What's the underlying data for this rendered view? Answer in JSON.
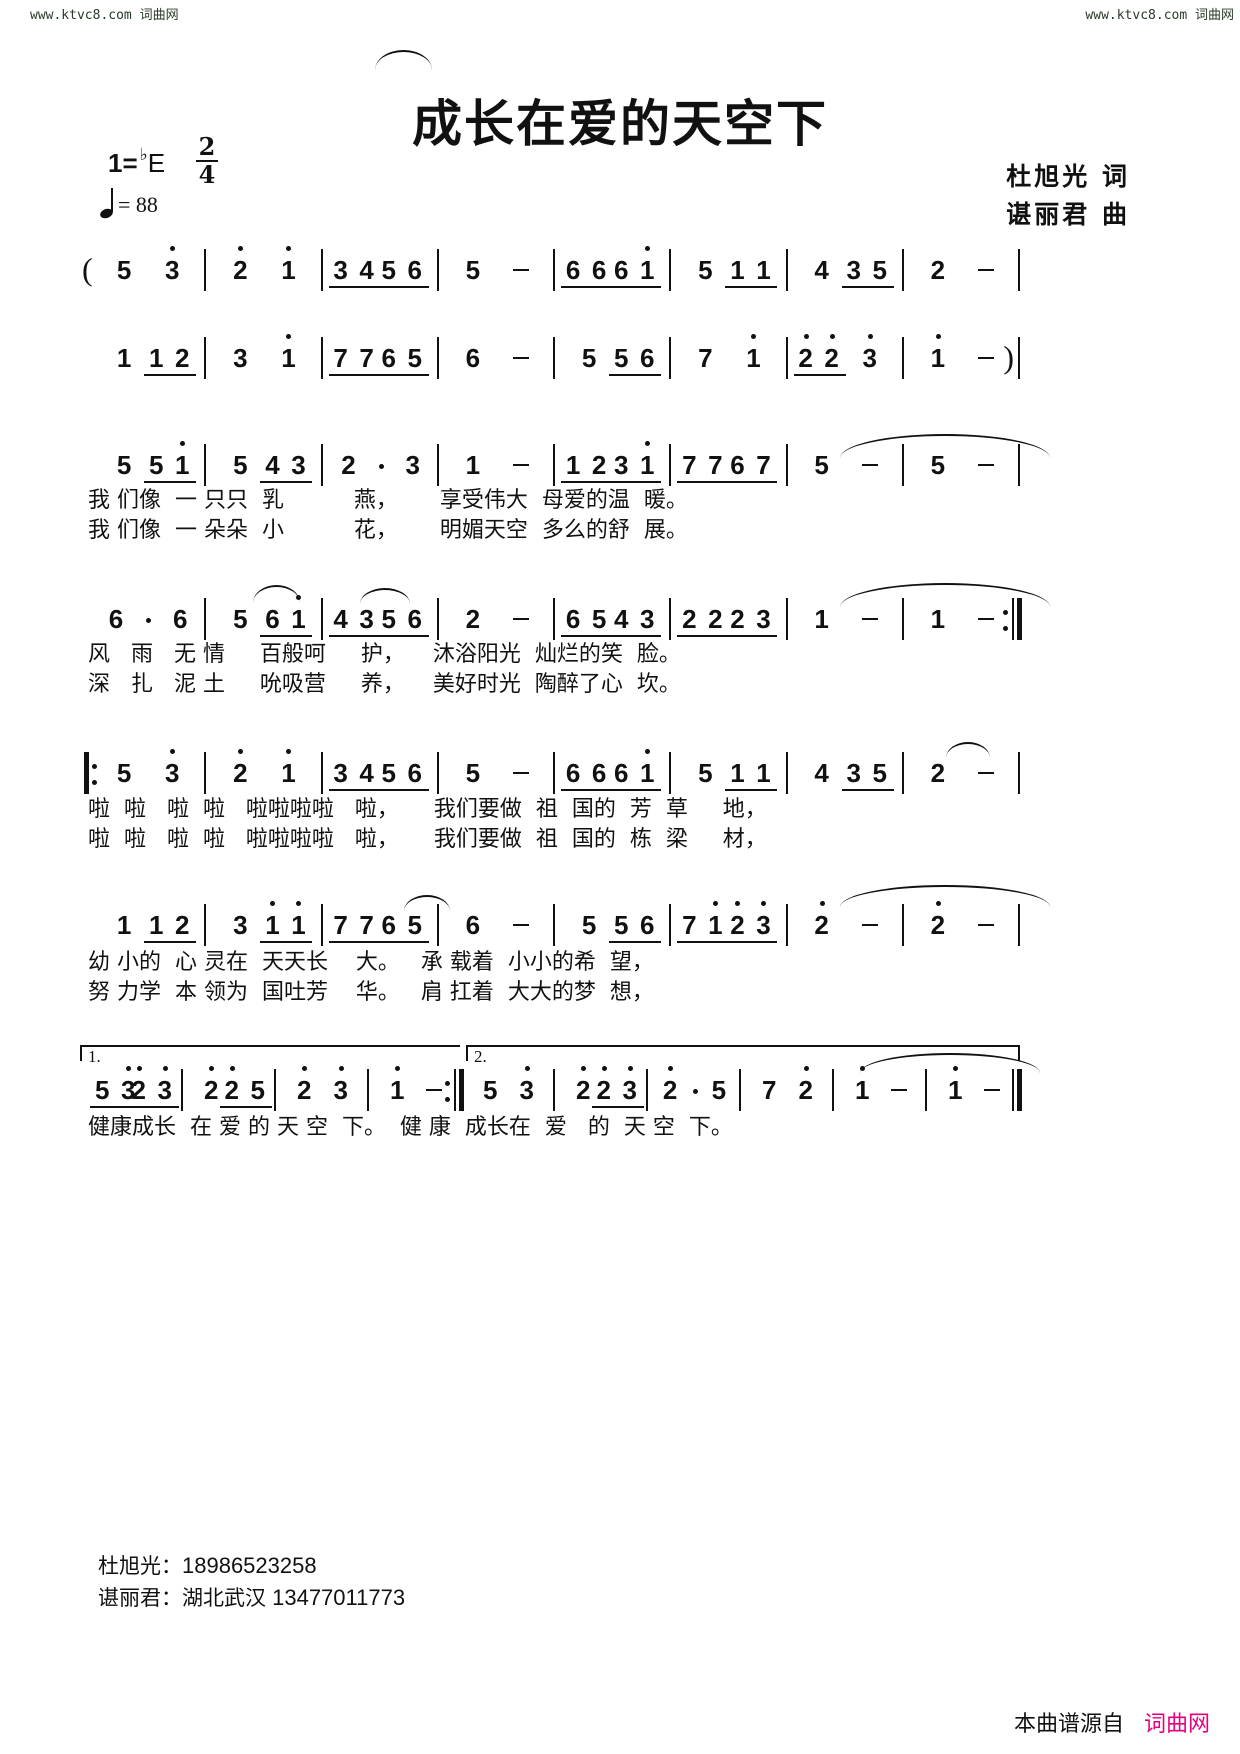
{
  "watermark": {
    "left": "www.ktvc8.com 词曲网",
    "right": "www.ktvc8.com 词曲网"
  },
  "title": "成长在爱的天空下",
  "key": {
    "prefix": "1=",
    "accidental": "♭",
    "letter": "E"
  },
  "time_signature": {
    "top": "2",
    "bottom": "4"
  },
  "tempo": {
    "unit": "quarter-note",
    "equals": "= 88"
  },
  "credits": {
    "lyricist": "杜旭光 词",
    "composer": "谌丽君 曲"
  },
  "score": {
    "lines": [
      {
        "measures": [
          [
            "(",
            "5",
            "3̇"
          ],
          [
            "2̇",
            "1̇"
          ],
          [
            "3 4",
            "5 6"
          ],
          [
            "5",
            "–"
          ],
          [
            "6 6",
            "6 1̇"
          ],
          [
            "5",
            "1 1"
          ],
          [
            "4",
            "3 5"
          ],
          [
            "2",
            "–"
          ]
        ]
      },
      {
        "measures": [
          [
            "1",
            "1 2"
          ],
          [
            "3",
            "1̇"
          ],
          [
            "7 7",
            "6 5"
          ],
          [
            "6",
            "–"
          ],
          [
            "5",
            "5 6"
          ],
          [
            "7",
            "1̇"
          ],
          [
            "2̇ 2̇",
            "3̇"
          ],
          [
            "1̇",
            "–",
            ")"
          ]
        ]
      },
      {
        "measures": [
          [
            "5",
            "5 1̇"
          ],
          [
            "5",
            "4 3"
          ],
          [
            "2",
            "·",
            "3"
          ],
          [
            "1",
            "–"
          ],
          [
            "1 2",
            "3 1̇"
          ],
          [
            "7 7",
            "6 7"
          ],
          [
            "5",
            "–"
          ],
          [
            "5",
            "–"
          ]
        ],
        "lyrics": [
          "我 们像  一 只只  乳          燕，      享受伟大  母爱的温  暖。",
          "我 们像  一 朵朵  小          花，      明媚天空  多么的舒  展。"
        ]
      },
      {
        "measures": [
          [
            "6",
            "·",
            "6"
          ],
          [
            "5",
            "6 1̇"
          ],
          [
            "4 3",
            "5 6"
          ],
          [
            "2",
            "–"
          ],
          [
            "6 5",
            "4 3"
          ],
          [
            "2 2",
            "2 3"
          ],
          [
            "1",
            "–"
          ],
          [
            "1",
            "–",
            ":‖"
          ]
        ],
        "lyrics": [
          "风   雨   无 情     百般呵     护，    沐浴阳光  灿烂的笑  脸。",
          "深   扎   泥 土     吮吸营     养，    美好时光  陶醉了心  坎。"
        ]
      },
      {
        "measures": [
          [
            "‖:",
            "5",
            "3̇"
          ],
          [
            "2̇",
            "1̇"
          ],
          [
            "3 4",
            "5 6"
          ],
          [
            "5",
            "–"
          ],
          [
            "6 6",
            "6 1̇"
          ],
          [
            "5",
            "1 1"
          ],
          [
            "4",
            "3 5"
          ],
          [
            "2",
            "–"
          ]
        ],
        "lyrics": [
          "啦  啦   啦  啦   啦啦啦啦   啦，     我们要做  祖  国的  芳  草     地，",
          "啦  啦   啦  啦   啦啦啦啦   啦，     我们要做  祖  国的  栋  梁     材，"
        ]
      },
      {
        "measures": [
          [
            "1",
            "1 2"
          ],
          [
            "3",
            "1̇ 1̇"
          ],
          [
            "7 7",
            "6 5"
          ],
          [
            "6",
            "–"
          ],
          [
            "5",
            "5 6"
          ],
          [
            "7 1̇",
            "2̇ 3̇"
          ],
          [
            "2̇",
            "–"
          ],
          [
            "2̇",
            "–"
          ]
        ],
        "lyrics": [
          "幼 小的  心 灵在  天天长    大。   承 载着  小小的希  望，",
          "努 力学  本 领为  国吐芳    华。   肩 扛着  大大的梦  想，"
        ]
      },
      {
        "voltas": [
          "1.",
          "2."
        ],
        "measures": [
          [
            "5 3̇",
            "2̇ 3̇"
          ],
          [
            "2̇",
            "2̇ 5"
          ],
          [
            "2̇",
            "3̇"
          ],
          [
            "1̇",
            "–",
            ":‖"
          ],
          [
            "5",
            "3̇"
          ],
          [
            "2̇",
            "2̇ 3̇"
          ],
          [
            "2̇",
            "·",
            "5"
          ],
          [
            "7",
            "2̇"
          ],
          [
            "1̇",
            "–"
          ],
          [
            "1̇",
            "–",
            "‖"
          ]
        ],
        "lyrics": [
          "健康成长  在 爱 的 天 空  下。  健 康  成长在  爱   的  天 空  下。"
        ]
      }
    ]
  },
  "footer": {
    "contacts": [
      {
        "name": "杜旭光：",
        "value": "18986523258"
      },
      {
        "name": "谌丽君：湖北武汉",
        "value": " 13477011773"
      }
    ]
  },
  "source": {
    "label": "本曲谱源自",
    "brand": "词曲网",
    "brand_color": "#e6007e"
  }
}
